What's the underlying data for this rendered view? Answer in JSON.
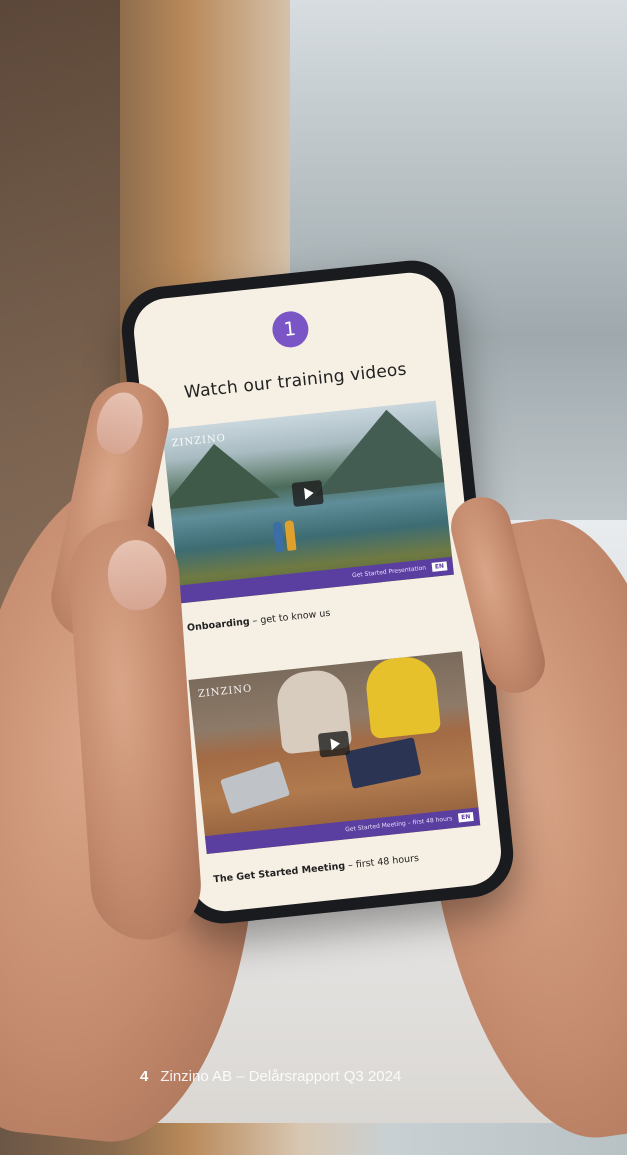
{
  "screen": {
    "step_number": "1",
    "title": "Watch our training videos",
    "videos": [
      {
        "brand": "ZINZINO",
        "bar_text": "Get Started Presentation",
        "language": "EN",
        "caption_bold": "Onboarding",
        "caption_rest": " – get to know us"
      },
      {
        "brand": "ZINZINO",
        "bar_text": "Get Started Meeting – first 48 hours",
        "language": "EN",
        "caption_bold": "The Get Started Meeting",
        "caption_rest": " – first 48 hours"
      }
    ]
  },
  "footer": {
    "page_number": "4",
    "title": "Zinzino AB – Delårsrapport Q3 2024"
  },
  "colors": {
    "accent": "#7a55c6",
    "video_bar": "#5b3fa0",
    "screen_bg": "#f6efe4"
  }
}
